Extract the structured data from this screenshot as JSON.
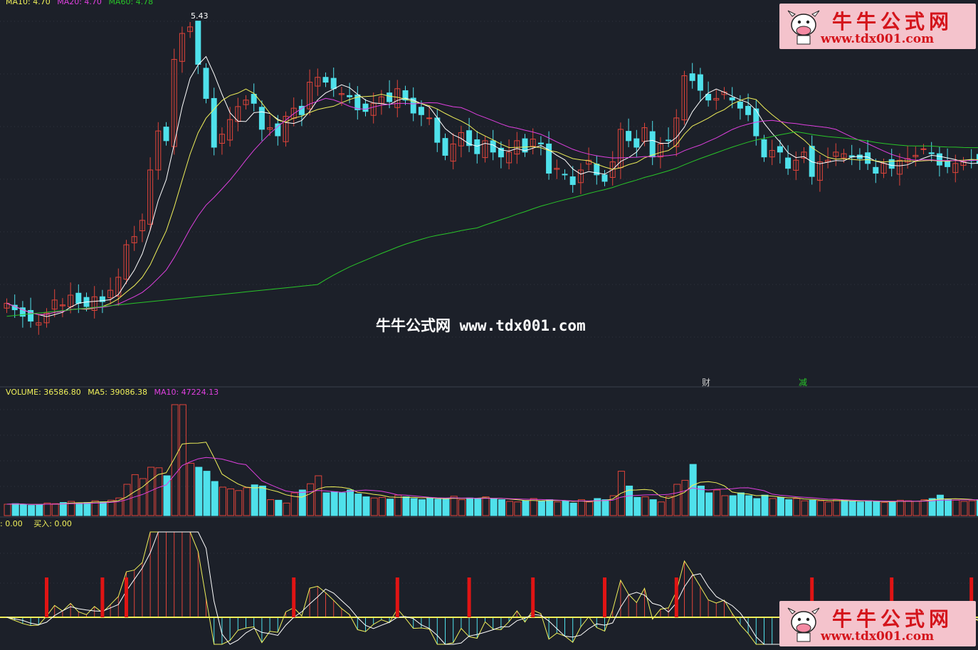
{
  "legend_top": {
    "ma10": "MA10: 4.70",
    "ma20": "MA20: 4.70",
    "ma60": "MA60: 4.78"
  },
  "high_label": "5.43",
  "volume_legend": {
    "volume": "VOLUME: 36586.80",
    "ma5": "MA5: 39086.38",
    "ma10": "MA10: 47224.13"
  },
  "indicator_legend": {
    "sell": "0.00",
    "buy": "买入: 0.00"
  },
  "event_marks": [
    "财",
    "减"
  ],
  "watermark_center": "牛牛公式网 www.tdx001.com",
  "watermark_box": {
    "title": "牛牛公式网",
    "url": "www.tdx001.com"
  },
  "colors": {
    "background": "#1c2029",
    "up": "#e0443a",
    "down": "#4fe1eb",
    "ma5": "#ffffff",
    "ma10": "#f0f05a",
    "ma20": "#e040e0",
    "ma60": "#29c529",
    "signal": "#e01414"
  },
  "chart_data": [
    {
      "type": "candlestick",
      "series": [
        {
          "name": "MA10",
          "color": "#f0f05a"
        },
        {
          "name": "MA20",
          "color": "#e040e0"
        },
        {
          "name": "MA60",
          "color": "#29c529"
        }
      ],
      "close": [
        3.7,
        3.66,
        3.62,
        3.59,
        3.58,
        3.64,
        3.72,
        3.69,
        3.75,
        3.7,
        3.68,
        3.74,
        3.71,
        3.78,
        3.86,
        4.06,
        4.11,
        4.21,
        4.52,
        4.76,
        4.7,
        5.2,
        5.36,
        5.4,
        5.17,
        4.96,
        4.66,
        4.74,
        4.83,
        4.91,
        4.95,
        4.93,
        4.77,
        4.78,
        4.73,
        4.85,
        4.9,
        4.86,
        5.06,
        5.09,
        5.06,
        5.02,
        4.99,
        4.97,
        4.89,
        4.88,
        4.93,
        4.97,
        4.94,
        5.02,
        4.95,
        4.87,
        4.86,
        4.84,
        4.69,
        4.61,
        4.68,
        4.75,
        4.67,
        4.62,
        4.7,
        4.63,
        4.6,
        4.63,
        4.7,
        4.63,
        4.71,
        4.68,
        4.5,
        4.53,
        4.49,
        4.43,
        4.52,
        4.58,
        4.49,
        4.45,
        4.57,
        4.77,
        4.7,
        4.66,
        4.78,
        4.6,
        4.68,
        4.7,
        4.84,
        5.1,
        5.07,
        5.01,
        4.95,
        4.96,
        5.0,
        4.95,
        4.9,
        4.86,
        4.73,
        4.6,
        4.64,
        4.63,
        4.53,
        4.58,
        4.63,
        4.48,
        4.57,
        4.58,
        4.63,
        4.62,
        4.6,
        4.59,
        4.56,
        4.5,
        4.56,
        4.53,
        4.58,
        4.59,
        4.61,
        4.65,
        4.62,
        4.55,
        4.54,
        4.56,
        4.57,
        4.58,
        4.56,
        4.59
      ],
      "high": 5.43
    },
    {
      "type": "bar",
      "title": "VOLUME",
      "series": [
        {
          "name": "VOLUME",
          "last": 36586.8
        },
        {
          "name": "MA5",
          "last": 39086.38
        },
        {
          "name": "MA10",
          "last": 47224.13
        }
      ],
      "values": [
        0.2,
        0.21,
        0.2,
        0.18,
        0.19,
        0.22,
        0.21,
        0.23,
        0.25,
        0.22,
        0.23,
        0.26,
        0.24,
        0.27,
        0.31,
        0.55,
        0.72,
        0.65,
        0.85,
        0.84,
        0.7,
        1.95,
        1.95,
        0.92,
        0.85,
        0.78,
        0.6,
        0.5,
        0.47,
        0.44,
        0.49,
        0.54,
        0.52,
        0.28,
        0.27,
        0.22,
        0.4,
        0.45,
        0.56,
        0.7,
        0.4,
        0.42,
        0.4,
        0.45,
        0.38,
        0.33,
        0.31,
        0.32,
        0.29,
        0.36,
        0.33,
        0.3,
        0.28,
        0.31,
        0.29,
        0.3,
        0.34,
        0.28,
        0.31,
        0.3,
        0.33,
        0.3,
        0.28,
        0.25,
        0.24,
        0.26,
        0.3,
        0.25,
        0.28,
        0.24,
        0.26,
        0.22,
        0.28,
        0.24,
        0.3,
        0.28,
        0.35,
        0.78,
        0.52,
        0.32,
        0.33,
        0.28,
        0.24,
        0.34,
        0.55,
        0.62,
        0.9,
        0.52,
        0.4,
        0.45,
        0.35,
        0.35,
        0.4,
        0.35,
        0.3,
        0.36,
        0.3,
        0.32,
        0.28,
        0.3,
        0.26,
        0.27,
        0.26,
        0.24,
        0.28,
        0.27,
        0.25,
        0.24,
        0.26,
        0.25,
        0.23,
        0.24,
        0.27,
        0.26,
        0.25,
        0.28,
        0.3,
        0.36,
        0.28,
        0.27,
        0.25,
        0.26,
        0.28,
        0.22
      ]
    },
    {
      "type": "line",
      "series": [
        {
          "name": "卖出",
          "last": 0.0
        },
        {
          "name": "买入",
          "last": 0.0
        }
      ],
      "signal_bar_index": [
        5,
        12,
        15,
        36,
        49,
        58,
        66,
        75,
        84,
        101,
        111,
        121
      ]
    }
  ]
}
